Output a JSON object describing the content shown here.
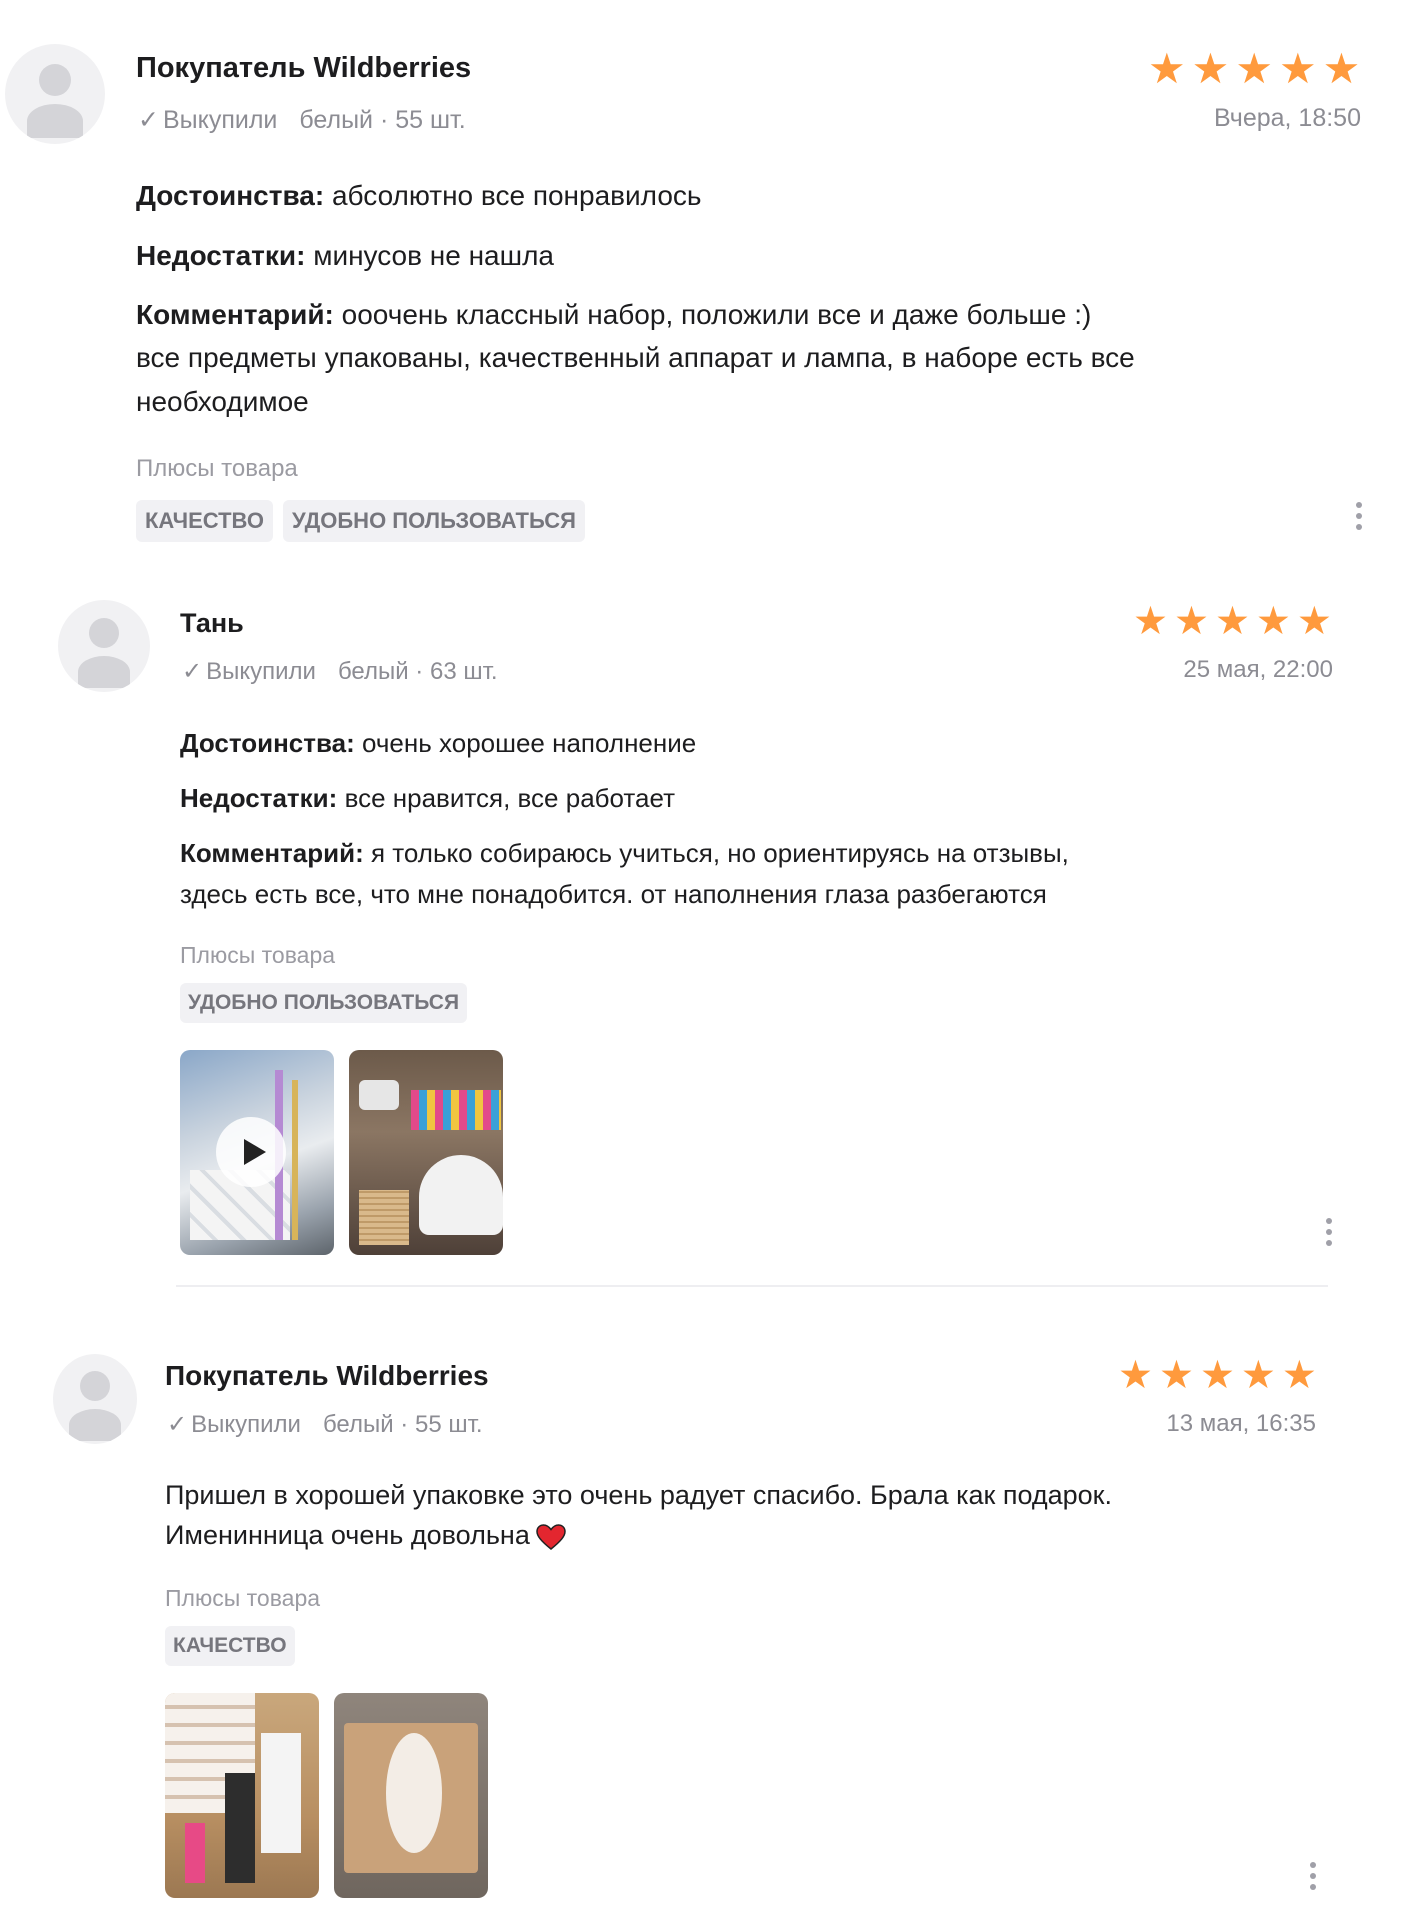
{
  "colors": {
    "star": "#ff9a3d",
    "muted": "#8c8c93",
    "tag_bg": "#f1f1f4"
  },
  "reviews": [
    {
      "author": "Покупатель Wildberries",
      "bought": "Выкупили",
      "variant": "белый · 55 шт.",
      "date": "Вчера, 18:50",
      "rating": 5,
      "pros_label": "Достоинства:",
      "pros": "абсолютно все понравилось",
      "cons_label": "Недостатки:",
      "cons": "минусов не нашла",
      "comment_label": "Комментарий:",
      "comment_line1": "ооочень классный набор, положили все и даже больше :)",
      "comment_line2": "все предметы упакованы, качественный аппарат и лампа, в наборе есть все",
      "comment_line3": "необходимое",
      "pluses_title": "Плюсы товара",
      "tags": [
        "КАЧЕСТВО",
        "УДОБНО ПОЛЬЗОВАТЬСЯ"
      ]
    },
    {
      "author": "Тань",
      "bought": "Выкупили",
      "variant": "белый · 63 шт.",
      "date": "25 мая, 22:00",
      "rating": 5,
      "pros_label": "Достоинства:",
      "pros": "очень хорошее наполнение",
      "cons_label": "Недостатки:",
      "cons": "все нравится, все работает",
      "comment_label": "Комментарий:",
      "comment_line1": "я только собираюсь учиться, но ориентируясь на отзывы,",
      "comment_line2": "здесь есть все, что мне понадобится. от наполнения глаза разбегаются",
      "pluses_title": "Плюсы товара",
      "tags": [
        "УДОБНО ПОЛЬЗОВАТЬСЯ"
      ]
    },
    {
      "author": "Покупатель Wildberries",
      "bought": "Выкупили",
      "variant": "белый · 55 шт.",
      "date": "13 мая, 16:35",
      "rating": 5,
      "text_line1": "Пришел в хорошей упаковке это очень радует спасибо. Брала как подарок.",
      "text_line2": "Именинница очень довольна",
      "pluses_title": "Плюсы товара",
      "tags": [
        "КАЧЕСТВО"
      ]
    }
  ]
}
